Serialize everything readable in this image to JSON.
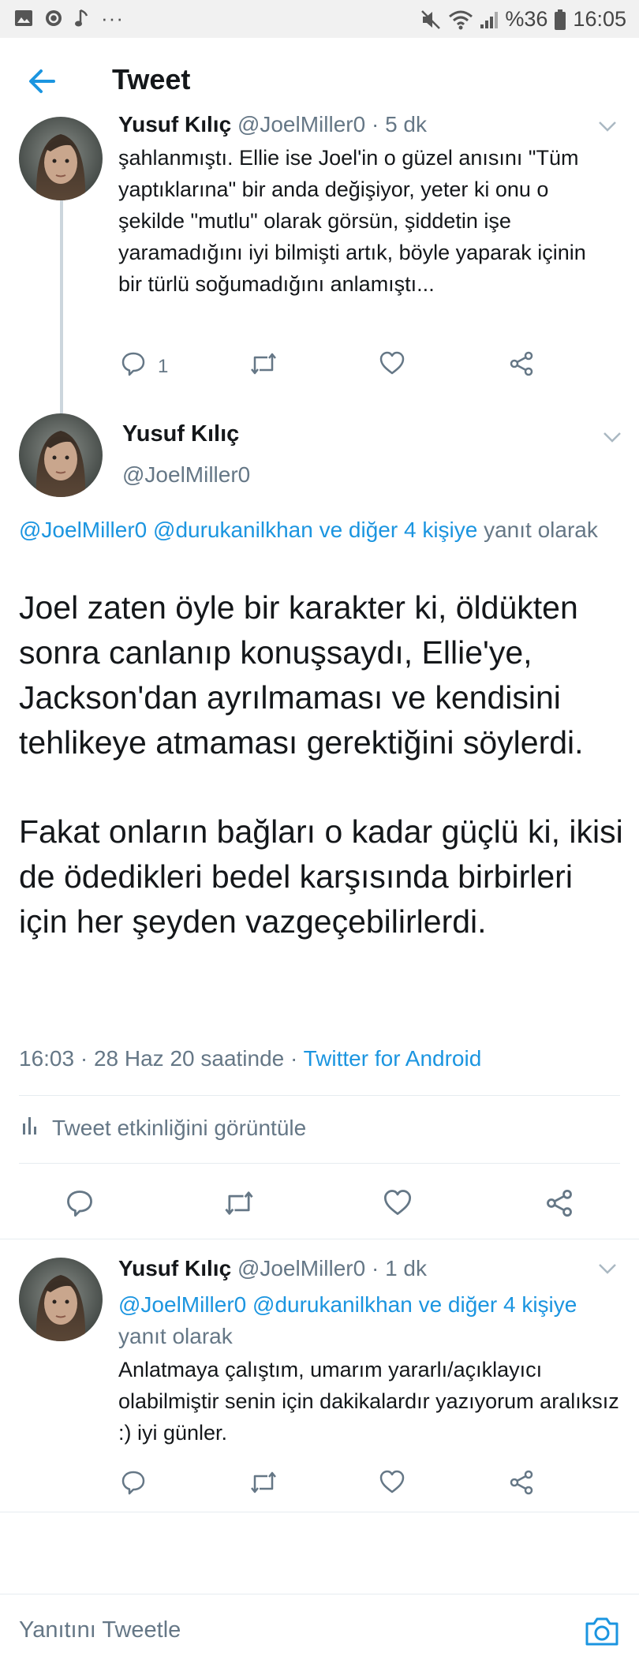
{
  "status_bar": {
    "battery_percent": "%36",
    "time": "16:05",
    "dots": "···"
  },
  "header": {
    "title": "Tweet"
  },
  "tweets": [
    {
      "name": "Yusuf Kılıç",
      "handle": "@JoelMiller0",
      "time": "· 5 dk",
      "text": "şahlanmıştı. Ellie ise Joel'in o güzel anısını \"Tüm yaptıklarına\" bir anda değişiyor, yeter ki onu o şekilde \"mutlu\" olarak görsün, şiddetin işe yaramadığını iyi bilmişti artık, böyle yaparak içinin bir türlü soğumadığını anlamıştı...",
      "reply_count": "1"
    },
    {
      "name": "Yusuf Kılıç",
      "handle": "@JoelMiller0",
      "reply_to_mentions": "@JoelMiller0 @durukanilkhan ve diğer 4 kişiye",
      "reply_to_suffix": " yanıt olarak",
      "paragraph_1": "Joel zaten öyle bir karakter ki, öldükten sonra canlanıp konuşsaydı, Ellie'ye, Jackson'dan ayrılmaması ve kendisini tehlikeye atmaması gerektiğini söylerdi.",
      "paragraph_2": "Fakat onların bağları o kadar güçlü ki, ikisi de ödedikleri bedel karşısında birbirleri için her şeyden vazgeçebilirlerdi.",
      "timestamp": "16:03 · 28 Haz 20 saatinde ·",
      "source": "Twitter for Android",
      "activity_label": "Tweet etkinliğini görüntüle"
    },
    {
      "name": "Yusuf Kılıç",
      "handle": "@JoelMiller0",
      "time": "· 1 dk",
      "reply_to_mentions": "@JoelMiller0 @durukanilkhan ve diğer 4 kişiye",
      "reply_to_suffix": " yanıt olarak",
      "text": "Anlatmaya çalıştım, umarım yararlı/açıklayıcı olabilmiştir senin için dakikalardır yazıyorum aralıksız :) iyi günler."
    }
  ],
  "compose": {
    "placeholder": "Yanıtını Tweetle"
  },
  "colors": {
    "accent": "#1b95e0",
    "secondary_text": "#657786",
    "divider": "#e6ecf0"
  }
}
